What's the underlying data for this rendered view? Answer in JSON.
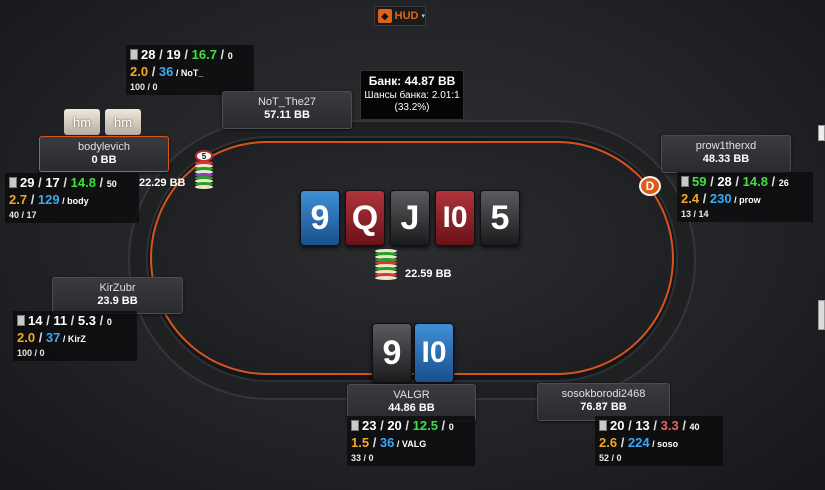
{
  "hud_button": {
    "label": "HUD",
    "logo": "hud-logo-icon"
  },
  "pot": {
    "main": "Банк: 44.87 BB",
    "odds": "Шансы банка: 2.01:1",
    "percent": "(33.2%)"
  },
  "board": [
    {
      "rank": "9",
      "suit": "diamonds",
      "color": "#2a6db5"
    },
    {
      "rank": "Q",
      "suit": "hearts",
      "color": "#8e222a"
    },
    {
      "rank": "J",
      "suit": "spades",
      "color": "#3a3b3e"
    },
    {
      "rank": "I0",
      "suit": "hearts",
      "color": "#8e222a"
    },
    {
      "rank": "5",
      "suit": "spades",
      "color": "#3a3b3e"
    }
  ],
  "pot_chips": {
    "amount": "22.59 BB"
  },
  "hero_cards": [
    {
      "rank": "9",
      "suit": "spades"
    },
    {
      "rank": "I0",
      "suit": "diamonds"
    }
  ],
  "dealer_button": "D",
  "hm_tiles": [
    "hm",
    "hm"
  ],
  "players": {
    "not_the27": {
      "name": "NoT_The27",
      "stack": "57.11 BB",
      "hud": {
        "r1": [
          "28",
          "19",
          "16.7",
          "0"
        ],
        "r2": [
          "2.0",
          "36",
          "NoT_"
        ],
        "r3": "100 / 0"
      }
    },
    "bodylevich": {
      "name": "bodylevich",
      "stack": "0 BB",
      "bet": "22.29 BB",
      "chip_label": "5",
      "hud": {
        "r1": [
          "29",
          "17",
          "14.8",
          "50"
        ],
        "r2": [
          "2.7",
          "129",
          "body"
        ],
        "r3": "40 / 17"
      }
    },
    "prow1therxd": {
      "name": "prow1therxd",
      "stack": "48.33 BB",
      "hud": {
        "r1": [
          "59",
          "28",
          "14.8",
          "26"
        ],
        "r2": [
          "2.4",
          "230",
          "prow"
        ],
        "r3": "13 / 14"
      }
    },
    "kirzubr": {
      "name": "KirZubr",
      "stack": "23.9 BB",
      "hud": {
        "r1": [
          "14",
          "11",
          "5.3",
          "0"
        ],
        "r2": [
          "2.0",
          "37",
          "KirZ"
        ],
        "r3": "100 / 0"
      }
    },
    "valgr": {
      "name": "VALGR",
      "stack": "44.86 BB",
      "hud": {
        "r1": [
          "23",
          "20",
          "12.5",
          "0"
        ],
        "r2": [
          "1.5",
          "36",
          "VALG"
        ],
        "r3": "33 / 0"
      }
    },
    "sosokborodi": {
      "name": "sosokborodi2468",
      "stack": "76.87 BB",
      "hud": {
        "r1": [
          "20",
          "13",
          "3.3",
          "40"
        ],
        "r2": [
          "2.6",
          "224",
          "soso"
        ],
        "r3": "52 / 0"
      }
    }
  },
  "colors": {
    "accent_orange": "#d4561c",
    "stat_green": "#3fe03f",
    "stat_orange": "#f5a623",
    "stat_blue": "#3ba8f5",
    "stat_red": "#f06060"
  }
}
